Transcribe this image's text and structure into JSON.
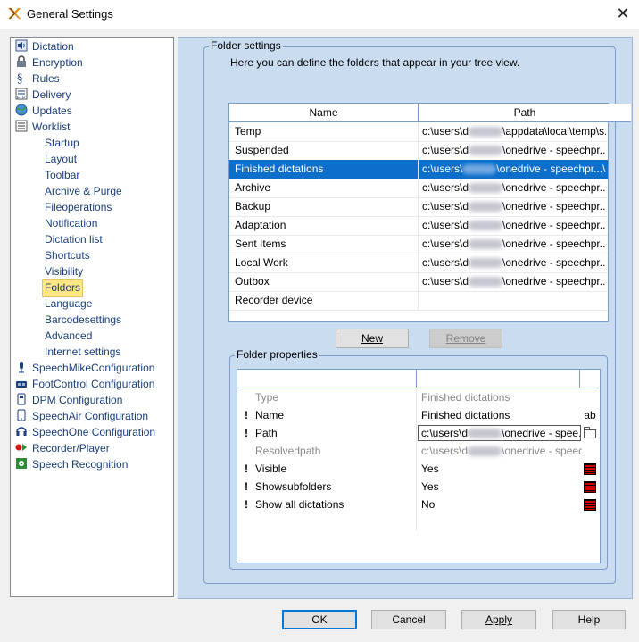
{
  "window": {
    "title": "General Settings",
    "close_glyph": "✕"
  },
  "tree": {
    "top_items": [
      {
        "label": "Dictation",
        "icon": "speaker-icon"
      },
      {
        "label": "Encryption",
        "icon": "lock-icon"
      },
      {
        "label": "Rules",
        "icon": "paragraph-icon"
      },
      {
        "label": "Delivery",
        "icon": "ftp-icon"
      },
      {
        "label": "Updates",
        "icon": "globe-icon"
      },
      {
        "label": "Worklist",
        "icon": "list-icon"
      }
    ],
    "worklist_children": [
      "Startup",
      "Layout",
      "Toolbar",
      "Archive & Purge",
      "Fileoperations",
      "Notification",
      "Dictation list",
      "Shortcuts",
      "Visibility",
      "Folders",
      "Language",
      "Barcodesettings",
      "Advanced",
      "Internet settings"
    ],
    "selected_child": "Folders",
    "bottom_items": [
      {
        "label": "SpeechMikeConfiguration",
        "icon": "microphone-icon"
      },
      {
        "label": "FootControl Configuration",
        "icon": "footcontrol-icon"
      },
      {
        "label": "DPM Configuration",
        "icon": "recorder-icon"
      },
      {
        "label": "SpeechAir Configuration",
        "icon": "phone-icon"
      },
      {
        "label": "SpeechOne Configuration",
        "icon": "headset-icon"
      },
      {
        "label": "Recorder/Player",
        "icon": "record-play-icon"
      },
      {
        "label": "Speech Recognition",
        "icon": "gear-icon"
      }
    ]
  },
  "folder_settings": {
    "legend": "Folder settings",
    "description": "Here you can define the folders that appear in your tree view.",
    "columns": {
      "name": "Name",
      "path": "Path"
    },
    "rows": [
      {
        "name": "Temp",
        "path_prefix": "c:\\users\\d",
        "path_suffix": "\\appdata\\local\\temp\\s...\\"
      },
      {
        "name": "Suspended",
        "path_prefix": "c:\\users\\d",
        "path_suffix": "\\onedrive - speechpr...\\"
      },
      {
        "name": "Finished dictations",
        "path_prefix": "c:\\users\\",
        "path_suffix": "\\onedrive - speechpr...\\"
      },
      {
        "name": "Archive",
        "path_prefix": "c:\\users\\d",
        "path_suffix": "\\onedrive - speechpr...\\"
      },
      {
        "name": "Backup",
        "path_prefix": "c:\\users\\d",
        "path_suffix": "\\onedrive - speechpr...\\"
      },
      {
        "name": "Adaptation",
        "path_prefix": "c:\\users\\d",
        "path_suffix": "\\onedrive - speechpr...\\"
      },
      {
        "name": "Sent Items",
        "path_prefix": "c:\\users\\d",
        "path_suffix": "\\onedrive - speechpr...\\"
      },
      {
        "name": "Local Work",
        "path_prefix": "c:\\users\\d",
        "path_suffix": "\\onedrive - speechpr...\\"
      },
      {
        "name": "Outbox",
        "path_prefix": "c:\\users\\d",
        "path_suffix": "\\onedrive - speechpr...\\"
      },
      {
        "name": "Recorder device",
        "path_prefix": "",
        "path_suffix": ""
      }
    ],
    "selected_index": 2,
    "new_label": "New",
    "remove_label": "Remove"
  },
  "folder_properties": {
    "legend": "Folder properties",
    "rows": [
      {
        "mark": "",
        "name": "Type",
        "value": "Finished dictations",
        "icon": "",
        "disabled": true
      },
      {
        "mark": "!",
        "name": "Name",
        "value": "Finished dictations",
        "icon": "ab",
        "disabled": false
      },
      {
        "mark": "!",
        "name": "Path",
        "value_prefix": "c:\\users\\d",
        "value_suffix": "\\onedrive - spee...\\",
        "icon": "folder",
        "disabled": false
      },
      {
        "mark": "",
        "name": "Resolvedpath",
        "value_prefix": "c:\\users\\d",
        "value_suffix": "\\onedrive - speech",
        "icon": "",
        "disabled": true
      },
      {
        "mark": "!",
        "name": "Visible",
        "value": "Yes",
        "icon": "flag",
        "disabled": false
      },
      {
        "mark": "!",
        "name": "Showsubfolders",
        "value": "Yes",
        "icon": "flag",
        "disabled": false
      },
      {
        "mark": "!",
        "name": "Show all dictations",
        "value": "No",
        "icon": "flag",
        "disabled": false
      }
    ]
  },
  "footer": {
    "ok": "OK",
    "cancel": "Cancel",
    "apply": "Apply",
    "help": "Help"
  },
  "colors": {
    "panel": "#c9dcf0",
    "selection": "#0d6fca",
    "tree_text": "#1a3e7a"
  }
}
